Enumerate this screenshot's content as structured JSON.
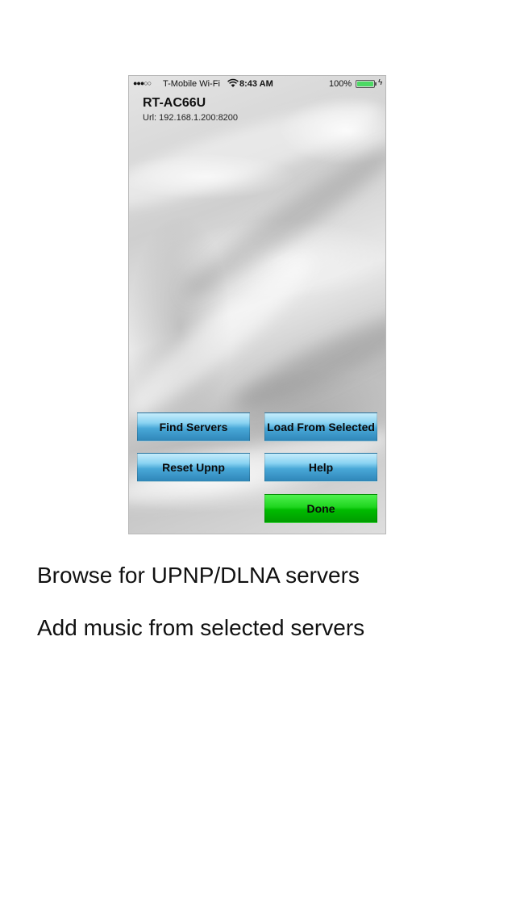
{
  "status_bar": {
    "signal": "●●●○○",
    "carrier": "T-Mobile Wi-Fi",
    "wifi_icon": "wifi-icon",
    "time": "8:43 AM",
    "battery_percent": "100%",
    "battery_level": 1.0,
    "battery_color": "#4cd964"
  },
  "server": {
    "name": "RT-AC66U",
    "url": "Url: 192.168.1.200:8200"
  },
  "buttons": {
    "find_servers": "Find Servers",
    "load_from_selected": "Load From Selected",
    "reset_upnp": "Reset Upnp",
    "help": "Help",
    "done": "Done"
  },
  "colors": {
    "button_blue": "#49a8d8",
    "button_green": "#00bb00"
  },
  "captions": [
    "Browse for UPNP/DLNA servers",
    "Add music from selected servers"
  ]
}
